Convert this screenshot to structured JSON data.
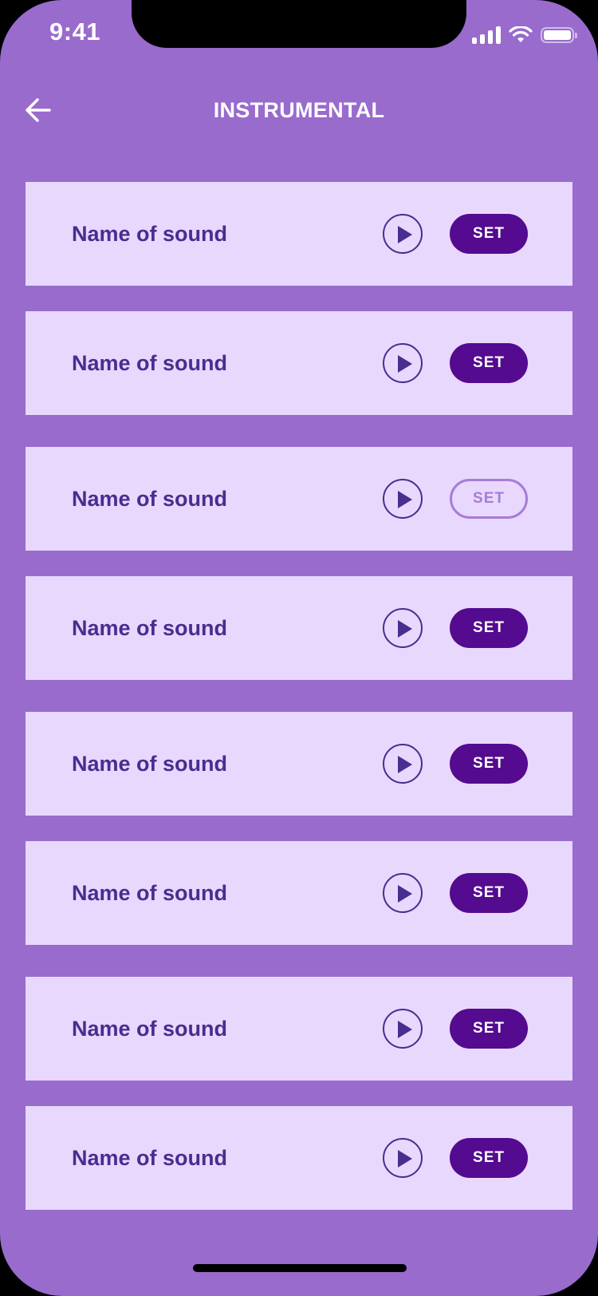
{
  "status_bar": {
    "time": "9:41",
    "icons": [
      "signal-icon",
      "wifi-icon",
      "battery-icon"
    ]
  },
  "header": {
    "back_icon": "arrow-left-icon",
    "title": "INSTRUMENTAL"
  },
  "sounds": [
    {
      "name": "Name of sound",
      "set_label": "SET",
      "set_state": "active"
    },
    {
      "name": "Name of sound",
      "set_label": "SET",
      "set_state": "active"
    },
    {
      "name": "Name of sound",
      "set_label": "SET",
      "set_state": "inactive"
    },
    {
      "name": "Name of sound",
      "set_label": "SET",
      "set_state": "active"
    },
    {
      "name": "Name of sound",
      "set_label": "SET",
      "set_state": "active"
    },
    {
      "name": "Name of sound",
      "set_label": "SET",
      "set_state": "active"
    },
    {
      "name": "Name of sound",
      "set_label": "SET",
      "set_state": "active"
    },
    {
      "name": "Name of sound",
      "set_label": "SET",
      "set_state": "active"
    }
  ],
  "colors": {
    "background": "#986bcd",
    "row_background": "#e8d8fd",
    "text": "#4b2c8f",
    "set_button": "#540b8f",
    "set_button_inactive": "#a77cd6"
  }
}
